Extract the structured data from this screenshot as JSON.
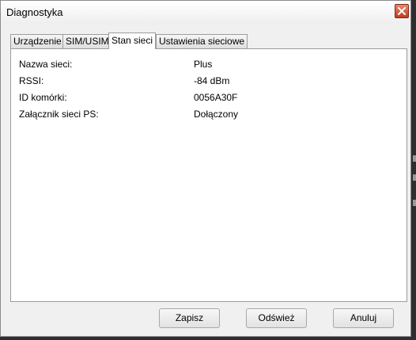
{
  "window": {
    "title": "Diagnostyka",
    "close_icon": "close-icon",
    "close_color": "#c43b1c"
  },
  "tabs": [
    {
      "label": "Urządzenie",
      "active": false
    },
    {
      "label": "SIM/USIM",
      "active": false
    },
    {
      "label": "Stan sieci",
      "active": true
    },
    {
      "label": "Ustawienia sieciowe",
      "active": false
    }
  ],
  "network_status": [
    {
      "label": "Nazwa sieci:",
      "value": "Plus"
    },
    {
      "label": "RSSI:",
      "value": "-84 dBm"
    },
    {
      "label": "ID komórki:",
      "value": "0056A30F"
    },
    {
      "label": "Załącznik sieci PS:",
      "value": "Dołączony"
    }
  ],
  "buttons": {
    "save": "Zapisz",
    "refresh": "Odśwież",
    "cancel": "Anuluj"
  }
}
